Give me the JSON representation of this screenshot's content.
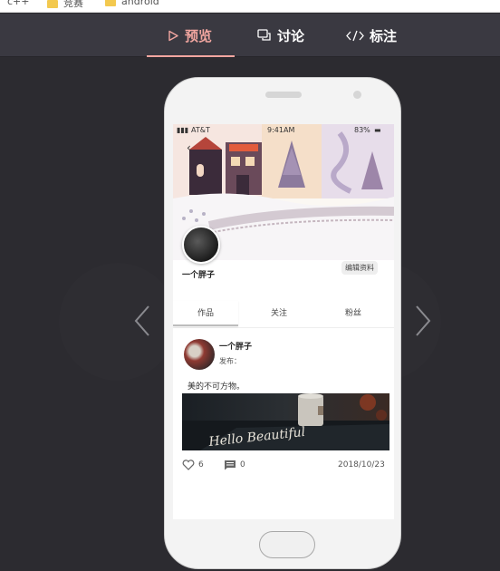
{
  "bookmarks": [
    {
      "label": "c++"
    },
    {
      "label": "竞赛"
    },
    {
      "label": "android"
    }
  ],
  "toolbar": {
    "tabs": [
      {
        "label": "预览",
        "icon": "play-icon",
        "active": true
      },
      {
        "label": "讨论",
        "icon": "chat-icon",
        "active": false
      },
      {
        "label": "标注",
        "icon": "code-icon",
        "active": false
      }
    ],
    "accent": "#f2a6a0"
  },
  "nav": {
    "prev_icon": "chevron-left-icon",
    "next_icon": "chevron-right-icon"
  },
  "phone": {
    "status": {
      "carrier": "AT&T",
      "time": "9:41AM",
      "battery": "83%"
    },
    "profile": {
      "username": "一个胖子",
      "edit_label": "编辑资料"
    },
    "tabs": [
      {
        "label": "作品",
        "active": true
      },
      {
        "label": "关注",
        "active": false
      },
      {
        "label": "粉丝",
        "active": false
      }
    ],
    "post": {
      "author": "一个胖子",
      "meta": "发布：",
      "text": "美的不可方物。",
      "image_caption": "Hello Beautiful",
      "likes": "6",
      "comments": "0",
      "date": "2018/10/23"
    }
  }
}
